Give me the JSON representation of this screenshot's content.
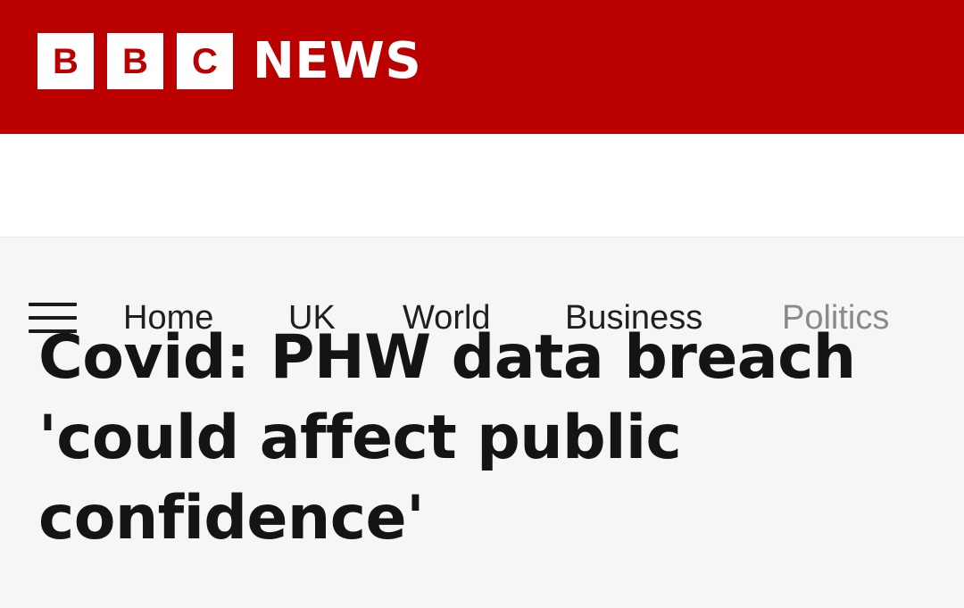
{
  "masthead": {
    "bbc_letters": [
      "B",
      "B",
      "C"
    ],
    "news_text": "NEWS",
    "brand_color": "#bb0000"
  },
  "nav": {
    "menu_icon": "hamburger-menu-icon",
    "items": [
      {
        "label": "Home"
      },
      {
        "label": "UK"
      },
      {
        "label": "World"
      },
      {
        "label": "Business"
      },
      {
        "label": "Politics"
      }
    ]
  },
  "article": {
    "headline": "Covid: PHW data breach 'could affect public confidence'"
  }
}
